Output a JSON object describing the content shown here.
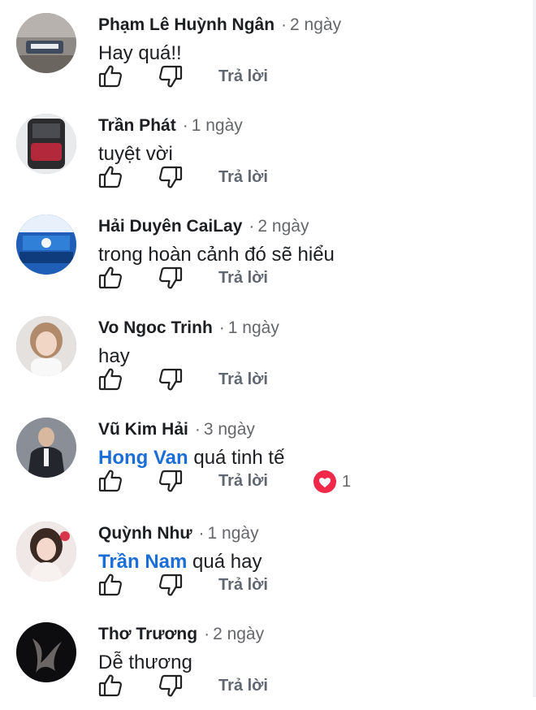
{
  "colors": {
    "author": "#1c1e21",
    "meta": "#65676b",
    "mention": "#1a6ed6",
    "reply": "#606770",
    "heart": "#f0284a"
  },
  "actions": {
    "like_icon": "thumbs-up-icon",
    "dislike_icon": "thumbs-down-icon",
    "reply_label": "Trả lời",
    "separator": "·"
  },
  "comments": [
    {
      "author": "Phạm Lê Huỳnh Ngân",
      "time": "2 ngày",
      "mention": "",
      "text": "Hay quá!!",
      "reaction_icon": "",
      "reaction_count": ""
    },
    {
      "author": "Trần Phát",
      "time": "1 ngày",
      "mention": "",
      "text": "tuyệt vời",
      "reaction_icon": "",
      "reaction_count": ""
    },
    {
      "author": "Hải Duyên CaiLay",
      "time": "2 ngày",
      "mention": "",
      "text": "trong hoàn cảnh đó sẽ hiểu",
      "reaction_icon": "",
      "reaction_count": ""
    },
    {
      "author": "Vo Ngoc Trinh",
      "time": "1 ngày",
      "mention": "",
      "text": "hay",
      "reaction_icon": "",
      "reaction_count": ""
    },
    {
      "author": "Vũ Kim Hải",
      "time": "3 ngày",
      "mention": "Hong Van",
      "text": "quá tinh tế",
      "reaction_icon": "heart-icon",
      "reaction_count": "1"
    },
    {
      "author": "Quỳnh Như",
      "time": "1 ngày",
      "mention": "Trần Nam",
      "text": "quá hay",
      "reaction_icon": "",
      "reaction_count": ""
    },
    {
      "author": "Thơ Trương",
      "time": "2 ngày",
      "mention": "",
      "text": "Dễ thương",
      "reaction_icon": "",
      "reaction_count": ""
    }
  ]
}
